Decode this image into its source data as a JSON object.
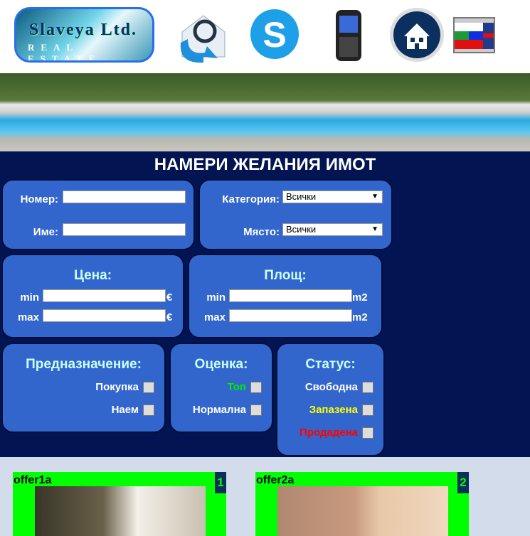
{
  "header": {
    "logo_line1": "Slaveya Ltd.",
    "logo_line2": "REAL ESTATE",
    "icons": [
      "email-icon",
      "skype-icon",
      "phone-icon",
      "home-icon",
      "language-flags-icon"
    ]
  },
  "search": {
    "title": "НАМЕРИ ЖЕЛАНИЯ ИМОТ",
    "number_label": "Номер:",
    "number_value": "",
    "name_label": "Име:",
    "name_value": "",
    "category_label": "Категория:",
    "category_value": "Всички",
    "place_label": "Място:",
    "place_value": "Всички",
    "price_title": "Цена:",
    "price_min_label": "min",
    "price_max_label": "max",
    "price_unit": "€",
    "area_title": "Площ:",
    "area_min_label": "min",
    "area_max_label": "max",
    "area_unit": "m2",
    "purpose_title": "Предназначение:",
    "purpose_options": [
      "Покупка",
      "Наем"
    ],
    "rating_title": "Оценка:",
    "rating_options": [
      "Топ",
      "Нормална"
    ],
    "status_title": "Статус:",
    "status_options": [
      "Свободна",
      "Запазена",
      "Продадена"
    ]
  },
  "colors": {
    "navy": "#021452",
    "panel": "#3366cc",
    "offer": "#00ff00",
    "top": "#00ee00",
    "reserved": "#ffff00",
    "sold": "#ff0000"
  },
  "offers": [
    {
      "name": "offer1a",
      "number": "1"
    },
    {
      "name": "offer2a",
      "number": "2"
    }
  ]
}
